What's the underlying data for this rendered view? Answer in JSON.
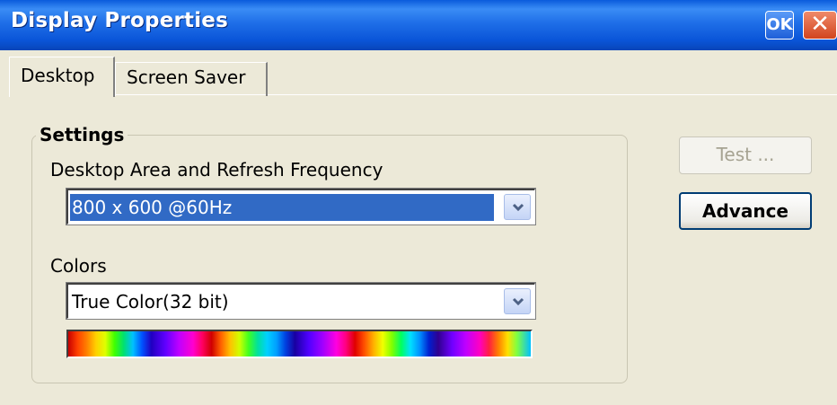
{
  "window": {
    "title": "Display Properties",
    "ok_label": "OK",
    "close_label": "✕"
  },
  "tabs": [
    {
      "label": "Desktop",
      "active": true
    },
    {
      "label": "Screen Saver",
      "active": false
    }
  ],
  "settings": {
    "group_label": "Settings",
    "resolution": {
      "label": "Desktop Area and Refresh Frequency",
      "value": "800 x 600 @60Hz"
    },
    "colors": {
      "label": "Colors",
      "value": "True Color(32 bit)"
    }
  },
  "buttons": {
    "test": "Test ...",
    "advance": "Advance"
  },
  "icons": {
    "dropdown": "chevron-down-icon",
    "close": "close-icon"
  },
  "theme": {
    "titlebar": "#0a55d8",
    "selection": "#316ac5",
    "background": "#ece9d8"
  }
}
